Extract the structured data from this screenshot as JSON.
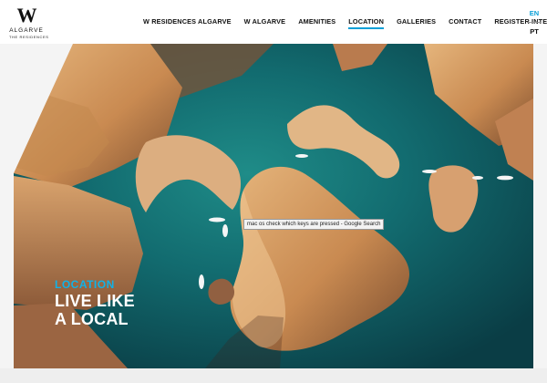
{
  "brand": {
    "mark": "W",
    "name": "ALGARVE",
    "subtitle": "THE RESIDENCES"
  },
  "nav": [
    {
      "label": "W RESIDENCES ALGARVE",
      "active": false
    },
    {
      "label": "W ALGARVE",
      "active": false
    },
    {
      "label": "AMENITIES",
      "active": false
    },
    {
      "label": "LOCATION",
      "active": true
    },
    {
      "label": "GALLERIES",
      "active": false
    },
    {
      "label": "CONTACT",
      "active": false
    },
    {
      "label": "REGISTER INTEREST",
      "active": false
    }
  ],
  "language": {
    "current": "EN",
    "alternate": "PT"
  },
  "hero": {
    "label": "LOCATION",
    "title": "LIVE LIKE\nA LOCAL",
    "image_icon": "aerial-coast-photo"
  },
  "tooltip": {
    "text": "mac os check which keys are pressed - Google Search"
  },
  "colors": {
    "accent": "#0aa0d8",
    "water": "#0f5c63",
    "rock": "#c9955e"
  }
}
